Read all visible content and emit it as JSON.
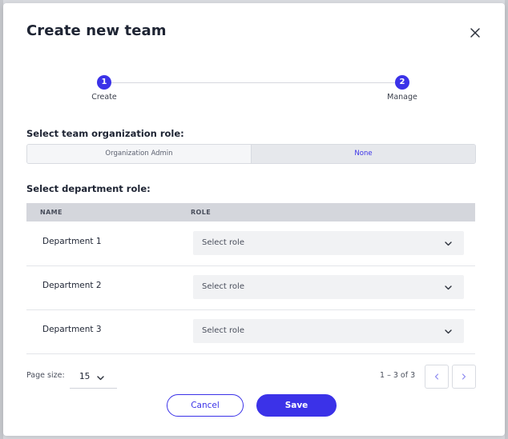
{
  "dialog": {
    "title": "Create new team"
  },
  "stepper": {
    "steps": [
      {
        "number": "1",
        "label": "Create"
      },
      {
        "number": "2",
        "label": "Manage"
      }
    ]
  },
  "org_role": {
    "label": "Select team organization role:",
    "options": [
      "Organization Admin",
      "None"
    ],
    "selected": "None"
  },
  "dept_role": {
    "label": "Select department role:",
    "columns": [
      "NAME",
      "ROLE"
    ],
    "rows": [
      {
        "name": "Department 1",
        "role_placeholder": "Select role"
      },
      {
        "name": "Department 2",
        "role_placeholder": "Select role"
      },
      {
        "name": "Department 3",
        "role_placeholder": "Select role"
      }
    ]
  },
  "pagination": {
    "page_size_label": "Page size:",
    "page_size": "15",
    "range": "1 – 3 of 3"
  },
  "actions": {
    "cancel": "Cancel",
    "save": "Save"
  },
  "colors": {
    "accent": "#3b32e8",
    "header_bg": "#d4d6dc"
  }
}
